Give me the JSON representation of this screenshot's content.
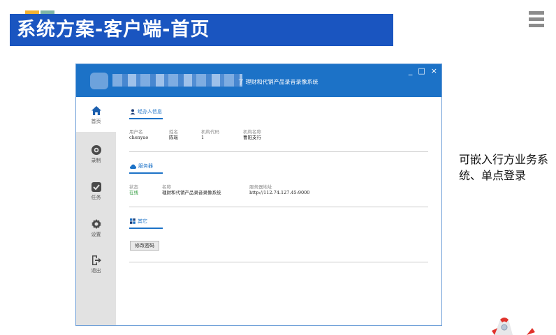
{
  "slide": {
    "title": "系统方案-客户端-首页",
    "caption": "可嵌入行方业务系统、单点登录",
    "accent_colors": [
      "#f2b233",
      "#7fb5a6"
    ],
    "banner_color": "#1a55c0"
  },
  "window": {
    "subtitle": "了 理财和代销产品录音录像系统",
    "controls": [
      "_",
      "□",
      "×"
    ],
    "titlebar_color": "#1c72c7"
  },
  "sidebar": {
    "items": [
      {
        "label": "首页",
        "icon": "home-icon",
        "active": true
      },
      {
        "label": "录制",
        "icon": "record-icon",
        "active": false
      },
      {
        "label": "任务",
        "icon": "task-check-icon",
        "active": false
      },
      {
        "label": "设置",
        "icon": "gear-icon",
        "active": false
      },
      {
        "label": "退出",
        "icon": "logout-icon",
        "active": false
      }
    ]
  },
  "agent_info": {
    "heading": "经办人信息",
    "fields": [
      {
        "label": "用户名",
        "value": "chenyao"
      },
      {
        "label": "姓名",
        "value": "陈瑶"
      },
      {
        "label": "机构代码",
        "value": "1"
      },
      {
        "label": "机构名称",
        "value": "曹阳支行"
      }
    ]
  },
  "server": {
    "heading": "服务器",
    "status_label": "状态",
    "status_value": "在线",
    "name_label": "名称",
    "name_value": "理财和代销产品录音录像系统",
    "address_label": "服务器地址",
    "address_value": "http://112.74.127.45:9000"
  },
  "other": {
    "heading": "其它",
    "change_password_label": "修改密码"
  }
}
